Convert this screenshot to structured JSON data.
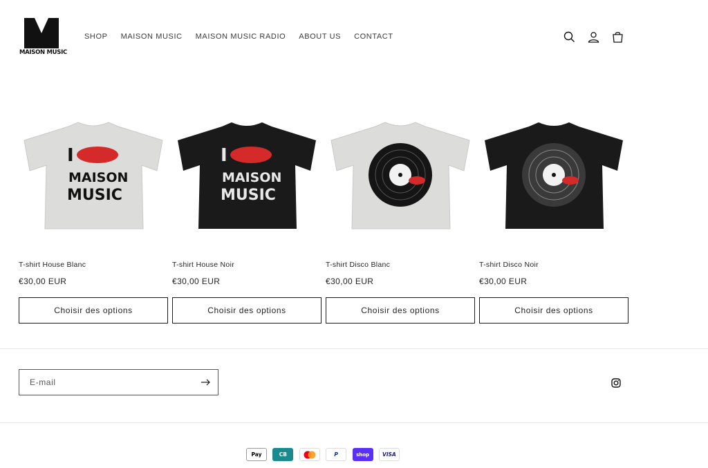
{
  "brand": {
    "logo_text": "MAISON MUSIC"
  },
  "nav": {
    "items": [
      "SHOP",
      "MAISON MUSIC",
      "MAISON MUSIC RADIO",
      "ABOUT US",
      "CONTACT"
    ]
  },
  "header_icons": [
    "search-icon",
    "account-icon",
    "cart-icon"
  ],
  "products": [
    {
      "title": "T-shirt House Blanc",
      "price": "€30,00 EUR",
      "button": "Choisir des options",
      "shirt_color": "#dcdcda",
      "print": "I ❤ MAISON MUSIC"
    },
    {
      "title": "T-shirt House Noir",
      "price": "€30,00 EUR",
      "button": "Choisir des options",
      "shirt_color": "#1a1a1a",
      "print": "I ❤ MAISON MUSIC"
    },
    {
      "title": "T-shirt Disco Blanc",
      "price": "€30,00 EUR",
      "button": "Choisir des options",
      "shirt_color": "#dcdcda",
      "print": "vinyl"
    },
    {
      "title": "T-shirt Disco Noir",
      "price": "€30,00 EUR",
      "button": "Choisir des options",
      "shirt_color": "#1a1a1a",
      "print": "vinyl"
    }
  ],
  "footer": {
    "email_placeholder": "E-mail",
    "social": [
      "instagram-icon"
    ],
    "payments": [
      {
        "name": "apple-pay-icon",
        "label": "Pay",
        "bg": "#ffffff",
        "fg": "#000000"
      },
      {
        "name": "cartes-bancaires-icon",
        "label": "CB",
        "bg": "#1b8a8f",
        "fg": "#ffffff"
      },
      {
        "name": "mastercard-icon",
        "label": "",
        "bg": "#ffffff",
        "fg": "#000000"
      },
      {
        "name": "paypal-icon",
        "label": "P",
        "bg": "#ffffff",
        "fg": "#003087"
      },
      {
        "name": "shop-pay-icon",
        "label": "shop",
        "bg": "#5a31f4",
        "fg": "#ffffff"
      },
      {
        "name": "visa-icon",
        "label": "VISA",
        "bg": "#ffffff",
        "fg": "#1a1f71"
      }
    ]
  },
  "colors": {
    "accent_red": "#d42a2a",
    "text": "#121212",
    "border": "#1a1a1a"
  }
}
